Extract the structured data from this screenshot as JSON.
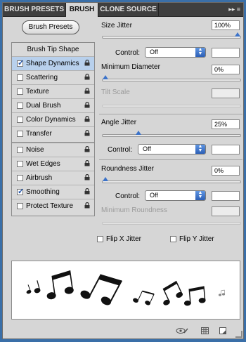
{
  "tabs": [
    {
      "label": "BRUSH PRESETS"
    },
    {
      "label": "BRUSH",
      "active": true
    },
    {
      "label": "CLONE SOURCE"
    }
  ],
  "tab_controls": "▸▸  ≡",
  "brush_presets_button": "Brush Presets",
  "left_panel": {
    "header": "Brush Tip Shape",
    "items": [
      {
        "label": "Shape Dynamics",
        "checked": true,
        "selected": true
      },
      {
        "label": "Scattering",
        "checked": false
      },
      {
        "label": "Texture",
        "checked": false
      },
      {
        "label": "Dual Brush",
        "checked": false
      },
      {
        "label": "Color Dynamics",
        "checked": false
      },
      {
        "label": "Transfer",
        "checked": false
      },
      {
        "label": "Noise",
        "checked": false
      },
      {
        "label": "Wet Edges",
        "checked": false
      },
      {
        "label": "Airbrush",
        "checked": false
      },
      {
        "label": "Smoothing",
        "checked": true
      },
      {
        "label": "Protect Texture",
        "checked": false
      }
    ]
  },
  "right_panel": {
    "size_jitter": {
      "label": "Size Jitter",
      "value": "100%",
      "slider": 1.0
    },
    "size_control": {
      "label": "Control:",
      "value": "Off"
    },
    "minimum_diameter": {
      "label": "Minimum Diameter",
      "value": "0%",
      "slider": 0.0
    },
    "tilt_scale": {
      "label": "Tilt Scale"
    },
    "angle_jitter": {
      "label": "Angle Jitter",
      "value": "25%",
      "slider": 0.25
    },
    "angle_control": {
      "label": "Control:",
      "value": "Off"
    },
    "roundness_jitter": {
      "label": "Roundness Jitter",
      "value": "0%",
      "slider": 0.0
    },
    "roundness_control": {
      "label": "Control:",
      "value": "Off"
    },
    "minimum_roundness": {
      "label": "Minimum Roundness"
    },
    "flip_x": {
      "label": "Flip X Jitter",
      "checked": false
    },
    "flip_y": {
      "label": "Flip Y Jitter",
      "checked": false
    }
  },
  "bottom_icons": [
    "eye-brush-icon",
    "grid-icon",
    "new-preset-icon"
  ],
  "accent_color": "#3c73c9"
}
